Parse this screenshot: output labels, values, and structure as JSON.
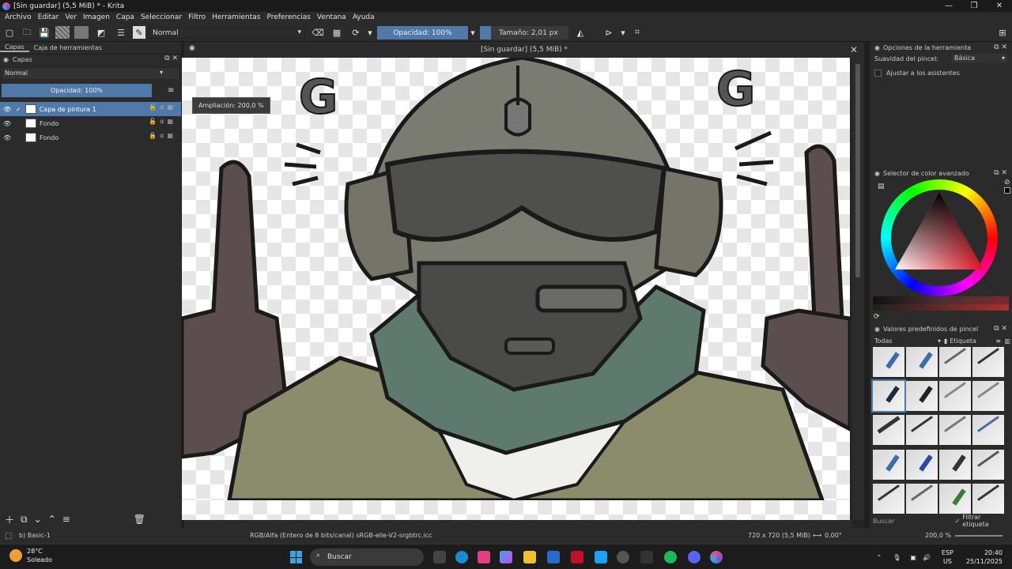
{
  "window": {
    "title": "[Sin guardar]  (5,5 MiB) * - Krita"
  },
  "menu": [
    "Archivo",
    "Editar",
    "Ver",
    "Imagen",
    "Capa",
    "Seleccionar",
    "Filtro",
    "Herramientas",
    "Preferencias",
    "Ventana",
    "Ayuda"
  ],
  "toolbar": {
    "blend_mode": "Normal",
    "opacity": "Opacidad: 100%",
    "size": "Tamaño: 2,01 px"
  },
  "left_panel": {
    "tabs": [
      "Capas",
      "Caja de herramientas"
    ],
    "dock_title": "Capas",
    "blend_mode": "Normal",
    "opacity": "Opacidad:  100%",
    "layers": [
      {
        "name": "Capa de pintura 1",
        "selected": true
      },
      {
        "name": "Fondo",
        "selected": false
      },
      {
        "name": "Fondo",
        "selected": false
      }
    ]
  },
  "document": {
    "tab_title": "[Sin guardar]  (5,5 MiB) *",
    "zoom_tip": "Ampliación: 200,0 %"
  },
  "tool_options": {
    "title": "Opciones de la herramienta",
    "smoothing_label": "Suavidad del pincel:",
    "smoothing_value": "Básica",
    "snap_label": "Ajustar a los asistentes"
  },
  "color_selector": {
    "title": "Selector de color avanzado"
  },
  "presets": {
    "title": "Valores predefinidos de pincel",
    "filter": "Todas",
    "tag_label": "Etiqueta",
    "search_placeholder": "Buscar",
    "filter_tag": "Filtrar etiqueta"
  },
  "status": {
    "brush": "b) Basic-1",
    "color_space": "RGB/Alfa (Entero de 8 bits/canal)  sRGB-elle-V2-srgbtrc.icc",
    "dims": "720 x 720 (5,5 MiB)",
    "rotation": "0,00°",
    "zoom": "200,0 %"
  },
  "taskbar": {
    "weather_temp": "28°C",
    "weather_desc": "Soleado",
    "search": "Buscar",
    "lang": "ESP",
    "region": "US",
    "time": "20:40",
    "date": "25/11/2025"
  }
}
